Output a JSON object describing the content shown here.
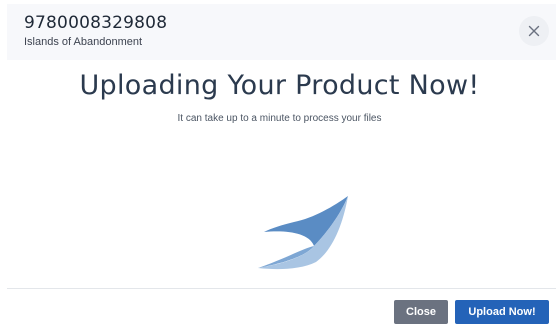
{
  "header": {
    "isbn": "9780008329808",
    "title": "Islands of Abandonment",
    "close_icon": "close-icon"
  },
  "body": {
    "heading": "Uploading Your Product Now!",
    "subtext": "It can take up to a minute to process your files",
    "spinner_icon": "loading-leaf-icon"
  },
  "footer": {
    "close_label": "Close",
    "upload_label": "Upload Now!"
  },
  "colors": {
    "header_bg": "#f7f8fb",
    "heading_text": "#2b3a4e",
    "close_button": "#6b7280",
    "upload_button": "#2463b8",
    "spinner_dark": "#5a8cc4",
    "spinner_light": "#a9c5e3"
  }
}
